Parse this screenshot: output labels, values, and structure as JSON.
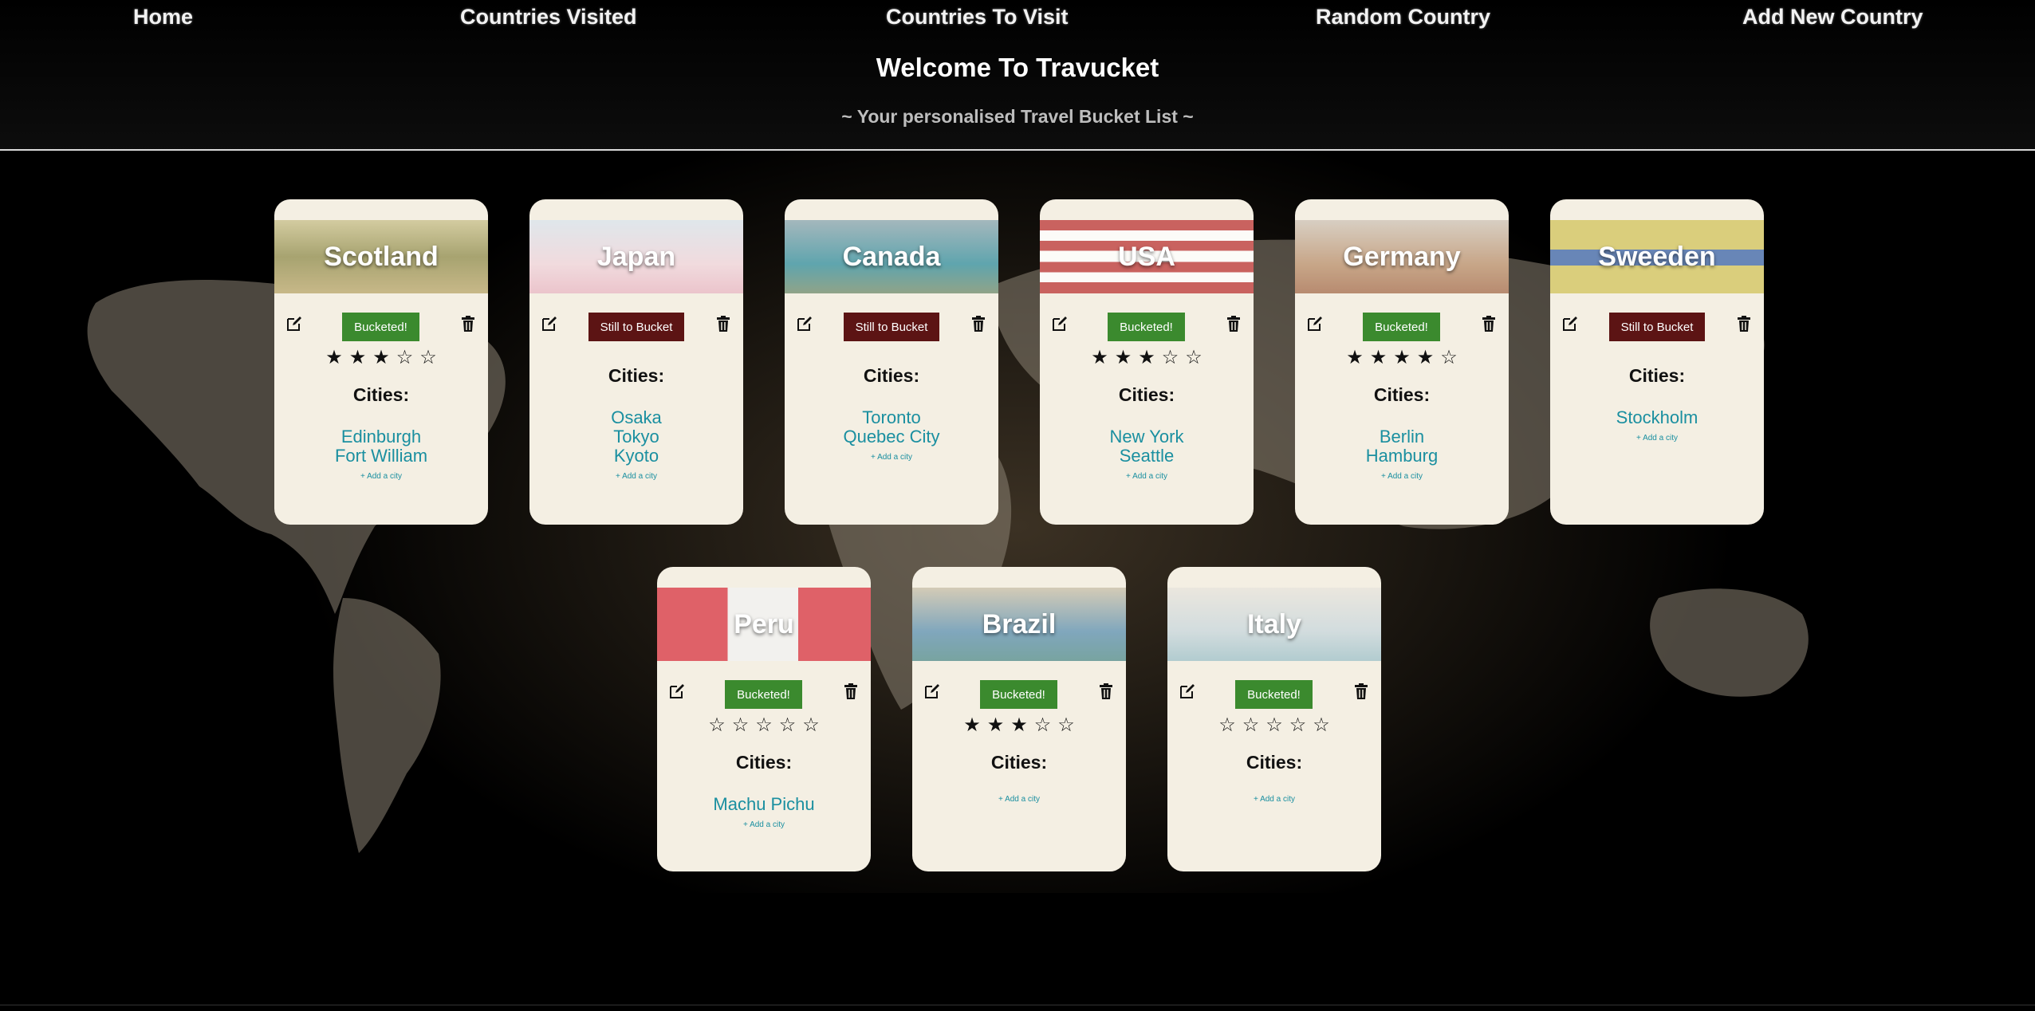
{
  "nav": {
    "home": "Home",
    "visited": "Countries Visited",
    "to_visit": "Countries To Visit",
    "random": "Random Country",
    "add_new": "Add New Country"
  },
  "header": {
    "title": "Welcome To Travucket",
    "subtitle": "~ Your personalised Travel Bucket List ~"
  },
  "colors": {
    "bucketed": "#3b8a2e",
    "still_to_bucket": "#5c1414",
    "city_link": "#1a8fa0",
    "card_bg": "#f4efe3"
  },
  "cities_heading": "Cities:",
  "add_city_label": "+ Add a city",
  "countries": [
    {
      "name": "Scotland",
      "status": "Bucketed!",
      "bucketed": true,
      "rating": 3,
      "cities": [
        "Edinburgh",
        "Fort William"
      ]
    },
    {
      "name": "Japan",
      "status": "Still to Bucket",
      "bucketed": false,
      "rating": null,
      "cities": [
        "Osaka",
        "Tokyo",
        "Kyoto"
      ]
    },
    {
      "name": "Canada",
      "status": "Still to Bucket",
      "bucketed": false,
      "rating": null,
      "cities": [
        "Toronto",
        "Quebec City"
      ]
    },
    {
      "name": "USA",
      "status": "Bucketed!",
      "bucketed": true,
      "rating": 3,
      "cities": [
        "New York",
        "Seattle"
      ]
    },
    {
      "name": "Germany",
      "status": "Bucketed!",
      "bucketed": true,
      "rating": 4,
      "cities": [
        "Berlin",
        "Hamburg"
      ]
    },
    {
      "name": "Sweeden",
      "status": "Still to Bucket",
      "bucketed": false,
      "rating": null,
      "cities": [
        "Stockholm"
      ]
    },
    {
      "name": "Peru",
      "status": "Bucketed!",
      "bucketed": true,
      "rating": 0,
      "cities": [
        "Machu Pichu"
      ]
    },
    {
      "name": "Brazil",
      "status": "Bucketed!",
      "bucketed": true,
      "rating": 3,
      "cities": []
    },
    {
      "name": "Italy",
      "status": "Bucketed!",
      "bucketed": true,
      "rating": 0,
      "cities": []
    }
  ]
}
